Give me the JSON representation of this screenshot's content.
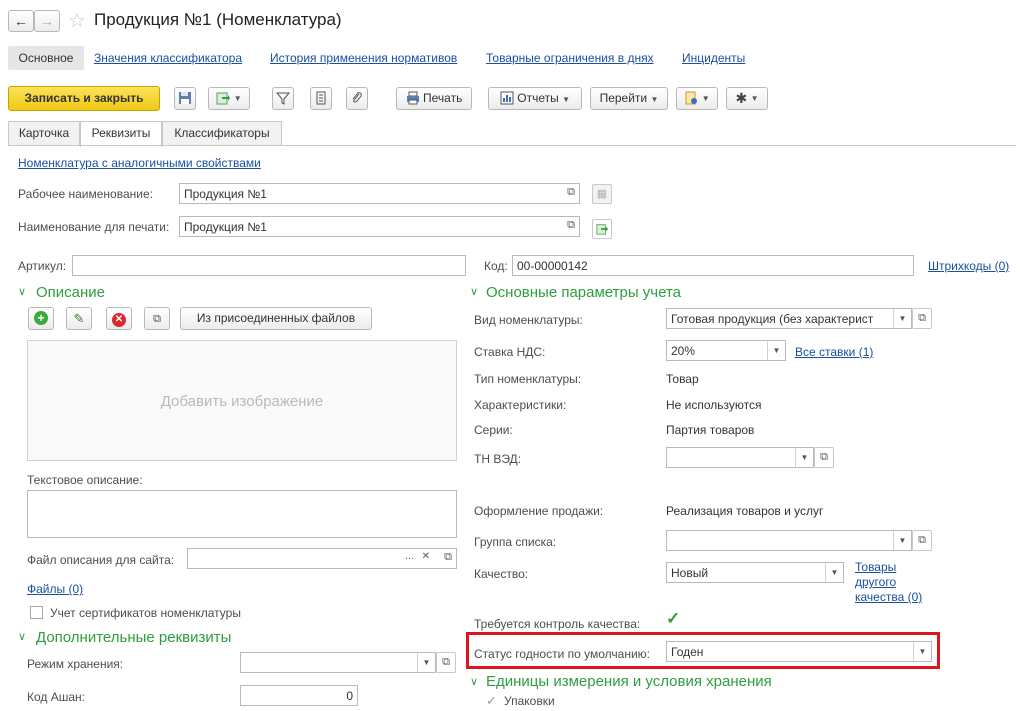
{
  "window": {
    "title": "Продукция №1 (Номенклатура)"
  },
  "nav_tabs": [
    "Основное",
    "Значения классификатора",
    "История применения нормативов",
    "Товарные ограничения в днях",
    "Инциденты"
  ],
  "toolbar": {
    "save_close": "Записать и закрыть",
    "print": "Печать",
    "reports": "Отчеты",
    "goto": "Перейти"
  },
  "form_tabs": [
    "Карточка",
    "Реквизиты",
    "Классификаторы"
  ],
  "similar_link": "Номенклатура с аналогичными свойствами",
  "fields": {
    "work_name_label": "Рабочее наименование:",
    "work_name_value": "Продукция №1",
    "print_name_label": "Наименование для печати:",
    "print_name_value": "Продукция №1",
    "article_label": "Артикул:",
    "article_value": "",
    "code_label": "Код:",
    "code_value": "00-00000142",
    "barcodes_link": "Штрихкоды (0)"
  },
  "description": {
    "title": "Описание",
    "from_files_button": "Из присоединенных файлов",
    "add_image": "Добавить изображение",
    "text_desc_label": "Текстовое описание:",
    "site_file_label": "Файл описания для сайта:",
    "files_link": "Файлы (0)",
    "cert_label": "Учет сертификатов номенклатуры"
  },
  "extra": {
    "title": "Дополнительные реквизиты",
    "storage_label": "Режим хранения:",
    "auchan_label": "Код Ашан:",
    "auchan_value": "0"
  },
  "params": {
    "title": "Основные параметры учета",
    "kind_label": "Вид номенклатуры:",
    "kind_value": "Готовая продукция (без характерист",
    "vat_label": "Ставка НДС:",
    "vat_value": "20%",
    "all_rates_link": "Все ставки (1)",
    "type_label": "Тип номенклатуры:",
    "type_value": "Товар",
    "chars_label": "Характеристики:",
    "chars_value": "Не используются",
    "series_label": "Серии:",
    "series_value": "Партия товаров",
    "tnved_label": "ТН ВЭД:",
    "sale_label": "Оформление продажи:",
    "sale_value": "Реализация товаров и услуг",
    "group_label": "Группа списка:",
    "quality_label": "Качество:",
    "quality_value": "Новый",
    "other_quality_link_1": "Товары",
    "other_quality_link_2": "другого",
    "other_quality_link_3": "качества (0)",
    "quality_control_label": "Требуется контроль качества:",
    "status_label": "Статус годности по умолчанию:",
    "status_value": "Годен"
  },
  "units": {
    "title": "Единицы измерения и условия хранения",
    "packages_label": "Упаковки"
  },
  "colors": {
    "accent_green": "#2e9e3e",
    "save_yellow": "#f5d42b",
    "link_blue": "#1a4fa3",
    "highlight_red": "#e0141e"
  }
}
